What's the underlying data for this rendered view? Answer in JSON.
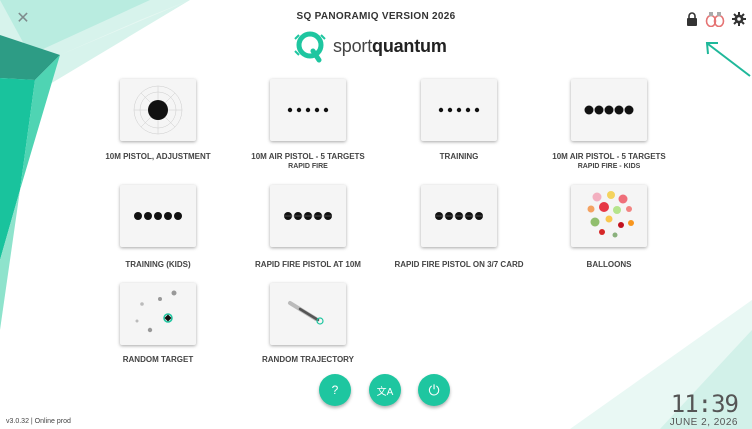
{
  "app": {
    "title": "SQ PANORAMIQ VERSION 2026",
    "logo_text_light": "sport",
    "logo_text_bold": "quantum",
    "close_glyph": "✕"
  },
  "top_icons": [
    "lock-icon",
    "hands-icon",
    "gear-icon"
  ],
  "tiles": [
    {
      "label": "10M PISTOL, ADJUSTMENT",
      "sublabel": "",
      "icon": "target-adjust-icon"
    },
    {
      "label": "10M AIR PISTOL - 5 TARGETS",
      "sublabel": "RAPID FIRE",
      "icon": "five-small-dots-icon"
    },
    {
      "label": "TRAINING",
      "sublabel": "",
      "icon": "five-small-dots-icon"
    },
    {
      "label": "10M AIR PISTOL - 5 TARGETS",
      "sublabel": "RAPID FIRE - KIDS",
      "icon": "five-large-dots-icon"
    },
    {
      "label": "TRAINING (KIDS)",
      "sublabel": "",
      "icon": "five-large-dots-icon"
    },
    {
      "label": "RAPID FIRE PISTOL AT 10M",
      "sublabel": "",
      "icon": "five-striped-dots-icon"
    },
    {
      "label": "RAPID FIRE PISTOL ON 3/7 CARD",
      "sublabel": "",
      "icon": "five-striped-dots-icon"
    },
    {
      "label": "BALLOONS",
      "sublabel": "",
      "icon": "balloons-icon"
    },
    {
      "label": "RANDOM TARGET",
      "sublabel": "",
      "icon": "random-target-icon"
    },
    {
      "label": "RANDOM TRAJECTORY",
      "sublabel": "",
      "icon": "random-trajectory-icon"
    }
  ],
  "bottom_buttons": [
    {
      "name": "help-button",
      "glyph": "?",
      "icon": "question-icon"
    },
    {
      "name": "language-button",
      "glyph": "文A",
      "icon": "translate-icon"
    },
    {
      "name": "power-button",
      "glyph": "⏻",
      "icon": "power-icon"
    }
  ],
  "footer": {
    "version": "v3.0.32 | Online prod",
    "time": "11:39",
    "date": "JUNE 2, 2026"
  },
  "colors": {
    "accent": "#1ec6a0",
    "accent_dark": "#0fa48a"
  }
}
